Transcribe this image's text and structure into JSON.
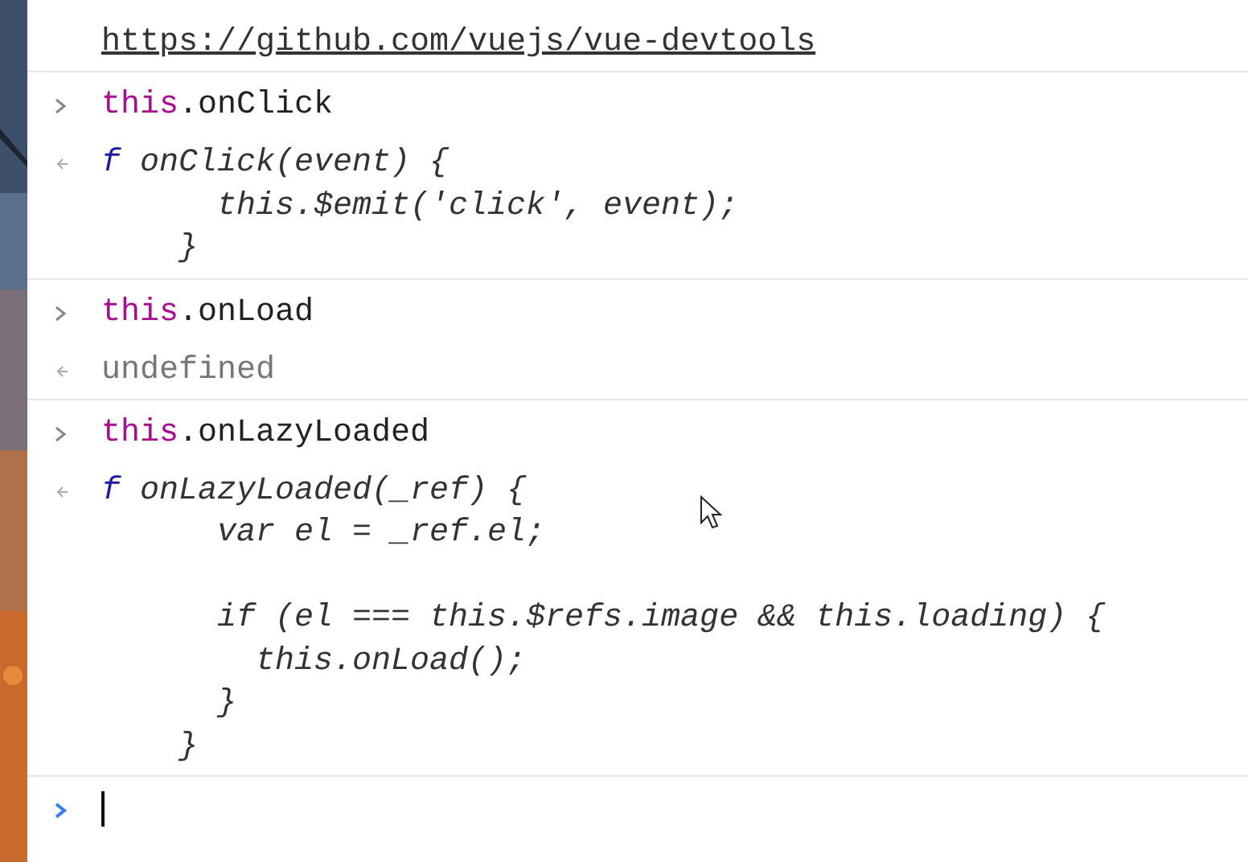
{
  "console": {
    "link": "https://github.com/vuejs/vue-devtools",
    "entries": [
      {
        "kind": "input",
        "keyword": "this",
        "text": ".onClick"
      },
      {
        "kind": "function",
        "marker": "f",
        "blocks": [
          [
            "onClick(event) {",
            "      this.$emit('click', event);",
            "    }"
          ]
        ]
      },
      {
        "kind": "input",
        "keyword": "this",
        "text": ".onLoad"
      },
      {
        "kind": "value",
        "text": "undefined"
      },
      {
        "kind": "input",
        "keyword": "this",
        "text": ".onLazyLoaded"
      },
      {
        "kind": "function",
        "marker": "f",
        "blocks": [
          [
            "onLazyLoaded(_ref) {",
            "      var el = _ref.el;"
          ],
          [
            "      if (el === this.$refs.image && this.loading) {",
            "        this.onLoad();",
            "      }",
            "    }"
          ]
        ]
      }
    ]
  }
}
